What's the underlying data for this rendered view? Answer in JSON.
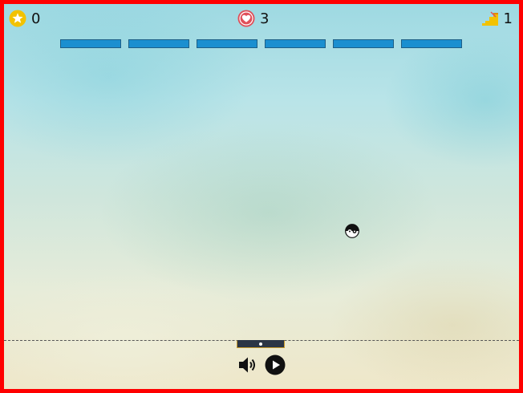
{
  "hud": {
    "score": "0",
    "lives": "3",
    "level": "1",
    "score_icon": "star-icon",
    "lives_icon": "heart-icon",
    "level_icon": "stairs-icon"
  },
  "bricks": {
    "count": 6,
    "color": "#1b8fd0"
  },
  "controls": {
    "sound_icon": "speaker-icon",
    "play_icon": "play-icon"
  },
  "colors": {
    "frame": "#ff0000",
    "paddle": "#2b3545",
    "star": "#f2c200",
    "heart": "#e0505a"
  }
}
